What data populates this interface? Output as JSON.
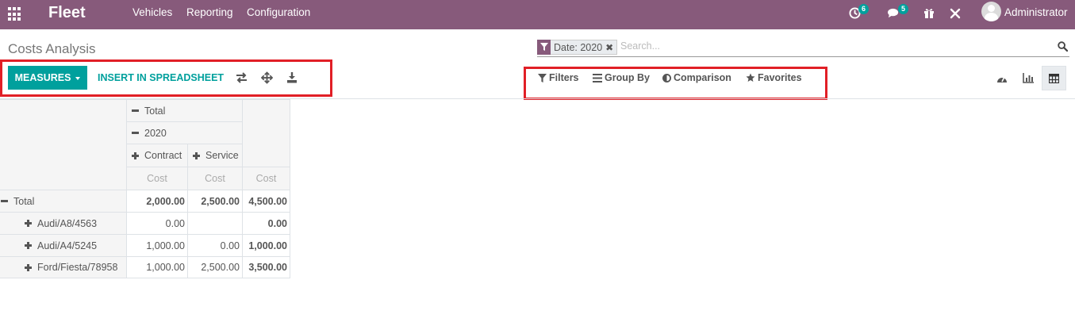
{
  "navbar": {
    "app_name": "Fleet",
    "menus": [
      "Vehicles",
      "Reporting",
      "Configuration"
    ],
    "activity_count": "6",
    "message_count": "5",
    "user_name": "Administrator",
    "bg_color": "#875a7b"
  },
  "control_panel": {
    "breadcrumb": "Costs Analysis",
    "search": {
      "facet_value": "Date: 2020",
      "placeholder": "Search..."
    },
    "buttons": {
      "measures": "MEASURES",
      "insert_spreadsheet": "INSERT IN SPREADSHEET"
    },
    "filters": {
      "filters_label": "Filters",
      "group_by_label": "Group By",
      "comparison_label": "Comparison",
      "favorites_label": "Favorites"
    },
    "accent_color": "#00a09d",
    "highlight_color": "#e11f26"
  },
  "pivot": {
    "col_headers": {
      "total": "Total",
      "year": "2020",
      "groups": [
        "Contract",
        "Service"
      ],
      "measure": "Cost"
    },
    "row_header_total": "Total",
    "total_row": {
      "contract": "2,000.00",
      "service": "2,500.00",
      "total": "4,500.00"
    },
    "rows": [
      {
        "label": "Audi/A8/4563",
        "contract": "0.00",
        "service": "",
        "total": "0.00"
      },
      {
        "label": "Audi/A4/5245",
        "contract": "1,000.00",
        "service": "0.00",
        "total": "1,000.00"
      },
      {
        "label": "Ford/Fiesta/78958",
        "contract": "1,000.00",
        "service": "2,500.00",
        "total": "3,500.00"
      }
    ]
  }
}
